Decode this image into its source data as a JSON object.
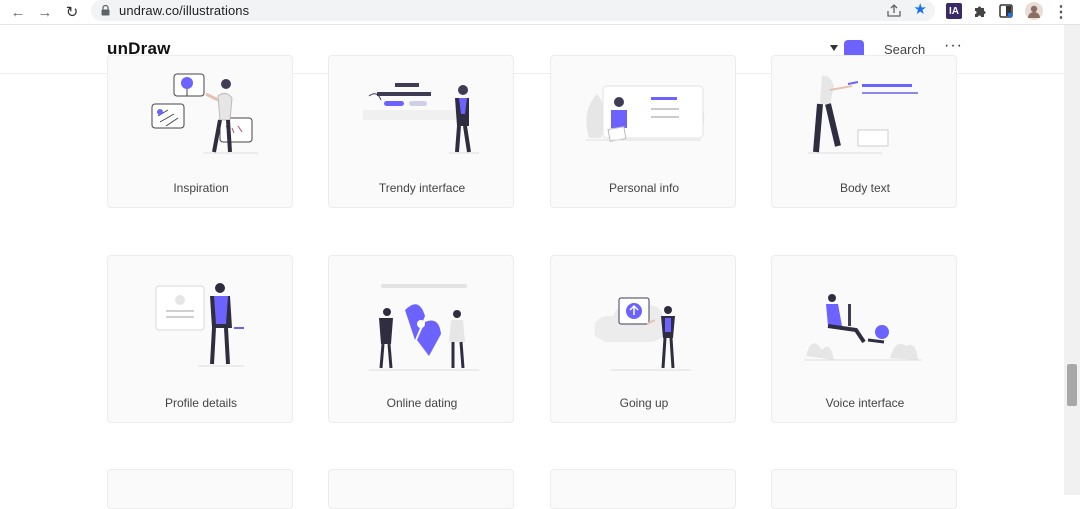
{
  "browser": {
    "url": "undraw.co/illustrations",
    "extension_ia_label": "IA"
  },
  "site": {
    "logo": "unDraw",
    "accent_color": "#6c63ff",
    "search_label": "Search",
    "more_label": "···"
  },
  "illustrations": [
    {
      "title": "Inspiration"
    },
    {
      "title": "Trendy interface"
    },
    {
      "title": "Personal info"
    },
    {
      "title": "Body text"
    },
    {
      "title": "Profile details"
    },
    {
      "title": "Online dating"
    },
    {
      "title": "Going up"
    },
    {
      "title": "Voice interface"
    }
  ]
}
